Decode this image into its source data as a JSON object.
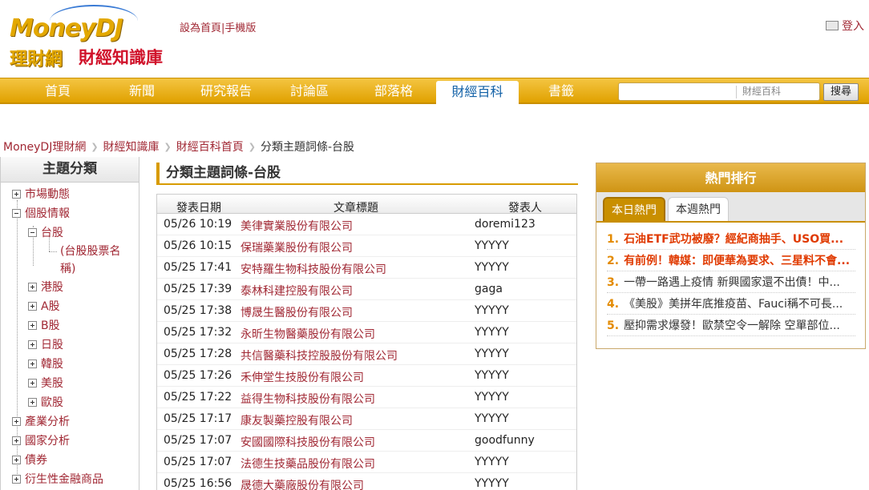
{
  "logo": {
    "brand_money": "Money",
    "brand_dj": "DJ",
    "sub1": "理財網",
    "sub2": "財經知識庫"
  },
  "toplinks": {
    "home_set": "設為首頁",
    "sep": "|",
    "mobile": "手機版"
  },
  "login": {
    "label": "登入"
  },
  "nav": {
    "items": [
      "首頁",
      "新聞",
      "研究報告",
      "討論區",
      "部落格",
      "財經百科",
      "書籤"
    ],
    "active_index": 5,
    "search_placeholder": "",
    "search_category": "財經百科",
    "search_button": "搜尋"
  },
  "breadcrumb": [
    "MoneyDJ理財網",
    "財經知識庫",
    "財經百科首頁",
    "分類主題詞條-台股"
  ],
  "sidebar": {
    "title": "主題分類",
    "items": [
      "市場動態",
      "個股情報",
      "台股",
      "(台股股票名",
      "稱)",
      "港股",
      "A股",
      "B股",
      "日股",
      "韓股",
      "美股",
      "歐股",
      "產業分析",
      "國家分析",
      "債券",
      "衍生性金融商品"
    ]
  },
  "main": {
    "title": "分類主題詞條-台股",
    "headers": {
      "date": "發表日期",
      "title": "文章標題",
      "author": "發表人"
    },
    "rows": [
      {
        "date": "05/26 10:19",
        "title": "美律實業股份有限公司",
        "author": "doremi123"
      },
      {
        "date": "05/26 10:15",
        "title": "保瑞藥業股份有限公司",
        "author": "YYYYY"
      },
      {
        "date": "05/25 17:41",
        "title": "安特羅生物科技股份有限公司",
        "author": "YYYYY"
      },
      {
        "date": "05/25 17:39",
        "title": "泰林科建控股有限公司",
        "author": "gaga"
      },
      {
        "date": "05/25 17:38",
        "title": "博晟生醫股份有限公司",
        "author": "YYYYY"
      },
      {
        "date": "05/25 17:32",
        "title": "永昕生物醫藥股份有限公司",
        "author": "YYYYY"
      },
      {
        "date": "05/25 17:28",
        "title": "共信醫藥科技控股股份有限公司",
        "author": "YYYYY"
      },
      {
        "date": "05/25 17:26",
        "title": "禾伸堂生技股份有限公司",
        "author": "YYYYY"
      },
      {
        "date": "05/25 17:22",
        "title": "益得生物科技股份有限公司",
        "author": "YYYYY"
      },
      {
        "date": "05/25 17:17",
        "title": "康友製藥控股有限公司",
        "author": "YYYYY"
      },
      {
        "date": "05/25 17:07",
        "title": "安國國際科技股份有限公司",
        "author": "goodfunny"
      },
      {
        "date": "05/25 17:07",
        "title": "法德生技藥品股份有限公司",
        "author": "YYYYY"
      },
      {
        "date": "05/25 16:56",
        "title": "晟德大藥廠股份有限公司",
        "author": "YYYYY"
      }
    ]
  },
  "hot": {
    "title": "熱門排行",
    "tab_today": "本日熱門",
    "tab_week": "本週熱門",
    "items": [
      {
        "num": "1.",
        "text": "石油ETF武功被廢？經紀商抽手、USO買..."
      },
      {
        "num": "2.",
        "text": "有前例！韓媒：即便華為要求、三星料不會..."
      },
      {
        "num": "3.",
        "text": "一帶一路遇上疫情 新興國家還不出債！中..."
      },
      {
        "num": "4.",
        "text": "《美股》美拼年底推疫苗、Fauci稱不可長..."
      },
      {
        "num": "5.",
        "text": "壓抑需求爆發！歐禁空令一解除 空單部位..."
      }
    ]
  },
  "colors": {
    "gold": "#e0a100",
    "link": "#a12834",
    "active_nav_text": "#0f5fa6",
    "hot_red": "#e03a00"
  }
}
